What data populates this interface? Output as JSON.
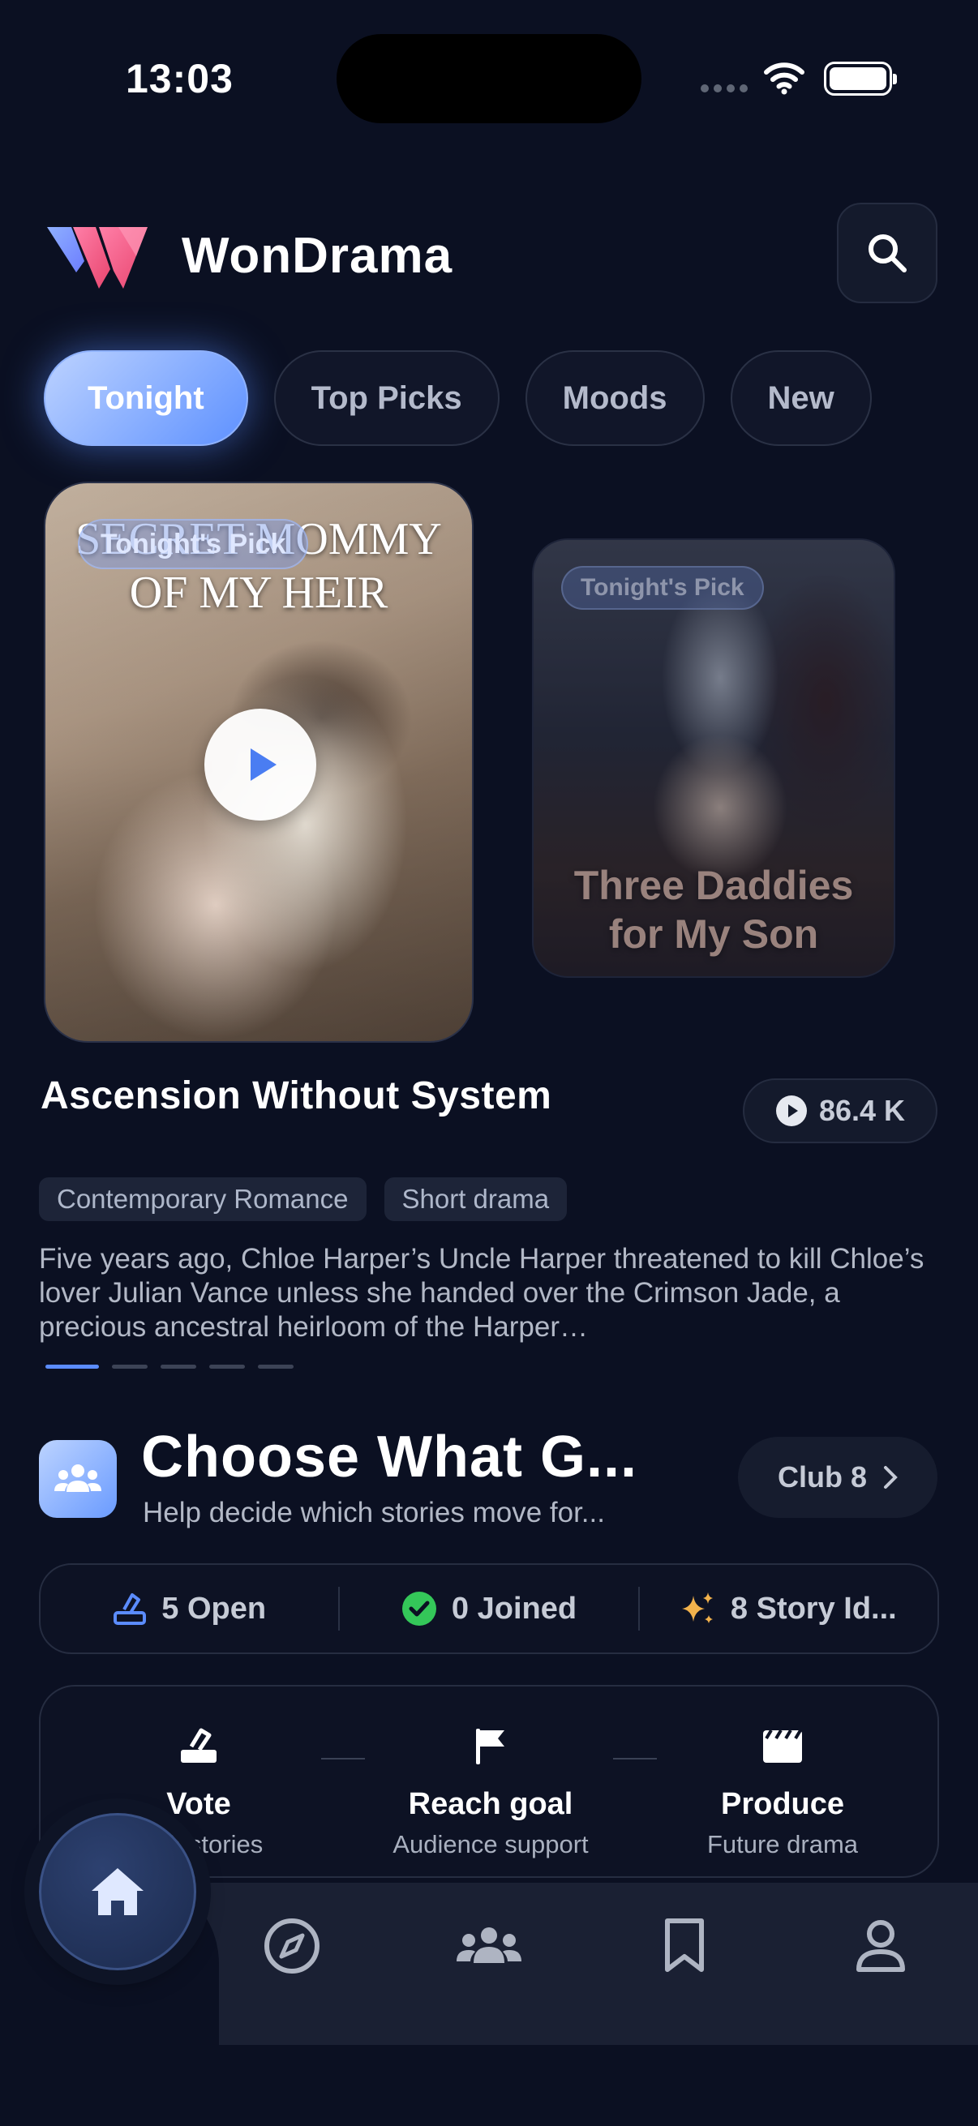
{
  "status_bar": {
    "time": "13:03"
  },
  "header": {
    "app_name": "WonDrama",
    "logo_icon": "wondrama-logo-icon",
    "search_icon": "search-icon"
  },
  "tabs": [
    {
      "label": "Tonight",
      "active": true
    },
    {
      "label": "Top Picks",
      "active": false
    },
    {
      "label": "Moods",
      "active": false
    },
    {
      "label": "New",
      "active": false
    }
  ],
  "carousel": {
    "main_card": {
      "badge": "Tonight's Pick",
      "poster_title_line1": "SECRET MOMMY",
      "poster_title_line2": "OF MY HEIR"
    },
    "side_card": {
      "badge": "Tonight's Pick",
      "poster_title_line1": "Three Daddies",
      "poster_title_line2": "for My Son"
    },
    "page_count": 5,
    "current_page": 1
  },
  "featured": {
    "title": "Ascension Without System",
    "views": "86.4 K",
    "tags": [
      "Contemporary Romance",
      "Short drama"
    ],
    "synopsis": "Five years ago, Chloe Harper’s Uncle Harper threatened to kill Chloe’s lover Julian Vance unless she handed over the Crimson Jade, a precious ancestral heirloom of the Harper…"
  },
  "club": {
    "title": "Choose What G...",
    "subtitle": "Help decide which stories move for...",
    "button_label": "Club 8",
    "stats": [
      {
        "label": "5 Open",
        "icon": "ballot-icon",
        "color": "#5b8cff"
      },
      {
        "label": "0 Joined",
        "icon": "check-circle-icon",
        "color": "#34c759"
      },
      {
        "label": "8 Story Id...",
        "icon": "sparkles-icon",
        "color": "#f2b24c"
      }
    ],
    "steps": [
      {
        "title": "Vote",
        "subtitle": "Pick stories",
        "icon": "ballot-icon"
      },
      {
        "title": "Reach goal",
        "subtitle": "Audience support",
        "icon": "flag-icon"
      },
      {
        "title": "Produce",
        "subtitle": "Future drama",
        "icon": "clapperboard-icon"
      }
    ]
  },
  "nav": [
    {
      "name": "home",
      "icon": "home-icon",
      "active": true
    },
    {
      "name": "explore",
      "icon": "compass-icon",
      "active": false
    },
    {
      "name": "club",
      "icon": "people-icon",
      "active": false
    },
    {
      "name": "saved",
      "icon": "bookmark-icon",
      "active": false
    },
    {
      "name": "profile",
      "icon": "person-icon",
      "active": false
    }
  ],
  "colors": {
    "background": "#0b1022",
    "accent": "#5b8cff",
    "nav_bar": "#1a2033"
  }
}
